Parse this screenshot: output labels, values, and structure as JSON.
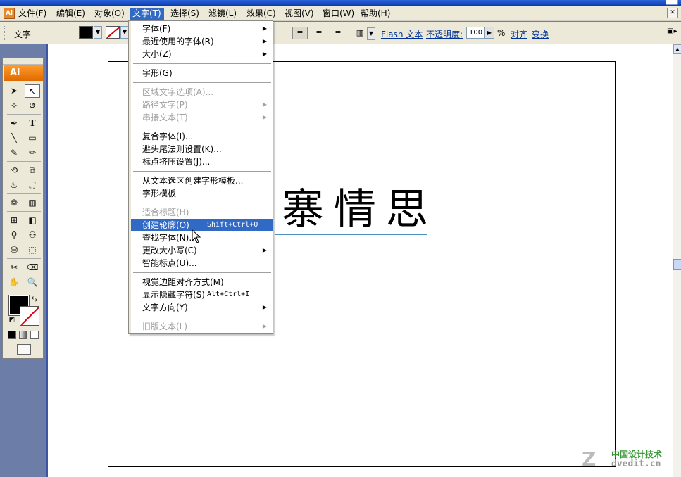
{
  "menubar": {
    "items": [
      {
        "label": "文件(F)"
      },
      {
        "label": "编辑(E)"
      },
      {
        "label": "对象(O)"
      },
      {
        "label": "文字(T)"
      },
      {
        "label": "选择(S)"
      },
      {
        "label": "滤镜(L)"
      },
      {
        "label": "效果(C)"
      },
      {
        "label": "视图(V)"
      },
      {
        "label": "窗口(W)"
      },
      {
        "label": "帮助(H)"
      }
    ]
  },
  "controlbar": {
    "label": "文字",
    "flash_text": "Flash 文本",
    "opacity_label": "不透明度:",
    "opacity_value": "100",
    "percent": "%",
    "align": "对齐",
    "transform": "变换"
  },
  "toolbox": {
    "logo": "Ai"
  },
  "canvas": {
    "text": "寨情思"
  },
  "type_menu": {
    "items": [
      {
        "label": "字体(F)",
        "submenu": true
      },
      {
        "label": "最近使用的字体(R)",
        "submenu": true
      },
      {
        "label": "大小(Z)",
        "submenu": true
      },
      {
        "label": "字形(G)"
      },
      {
        "label": "区域文字选项(A)...",
        "disabled": true
      },
      {
        "label": "路径文字(P)",
        "disabled": true,
        "submenu": true
      },
      {
        "label": "串接文本(T)",
        "disabled": true,
        "submenu": true
      },
      {
        "label": "复合字体(I)..."
      },
      {
        "label": "避头尾法则设置(K)..."
      },
      {
        "label": "标点挤压设置(J)..."
      },
      {
        "label": "从文本选区创建字形模板..."
      },
      {
        "label": "字形模板"
      },
      {
        "label": "适合标题(H)",
        "disabled": true
      },
      {
        "label": "创建轮廓(O)",
        "shortcut": "Shift+Ctrl+O",
        "highlighted": true
      },
      {
        "label": "查找字体(N)..."
      },
      {
        "label": "更改大小写(C)",
        "submenu": true
      },
      {
        "label": "智能标点(U)..."
      },
      {
        "label": "视觉边距对齐方式(M)"
      },
      {
        "label": "显示隐藏字符(S)",
        "shortcut": "Alt+Ctrl+I"
      },
      {
        "label": "文字方向(Y)",
        "submenu": true
      },
      {
        "label": "旧版文本(L)",
        "disabled": true,
        "submenu": true
      }
    ]
  },
  "watermark": {
    "line1": "中国设计技术",
    "line2": "dvedit.cn"
  },
  "colors": {
    "menu_highlight": "#316ac5",
    "toolbox_logo": "#f07d0f",
    "chrome": "#ece9d8"
  }
}
